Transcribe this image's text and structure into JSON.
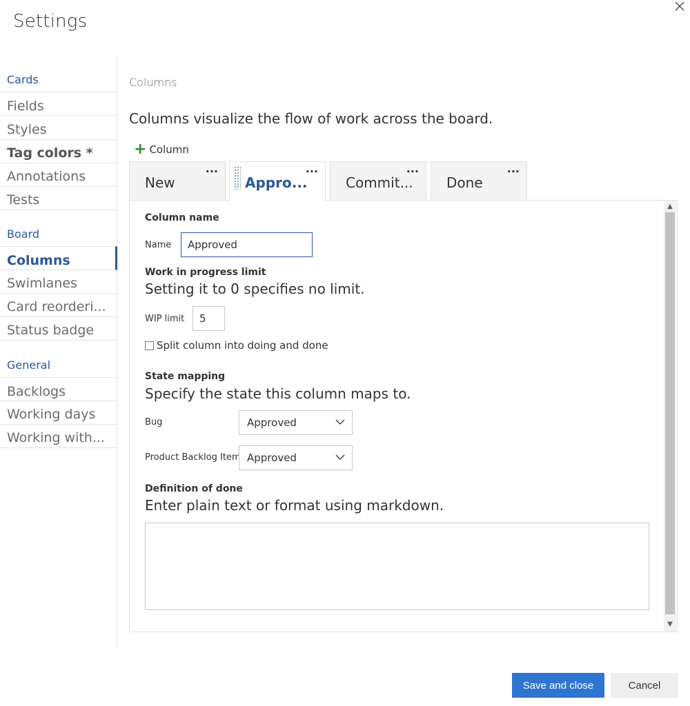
{
  "dialog": {
    "title": "Settings"
  },
  "sidebar": {
    "groups": [
      {
        "title": "Cards",
        "items": [
          "Fields",
          "Styles",
          "Tag colors *",
          "Annotations",
          "Tests"
        ]
      },
      {
        "title": "Board",
        "items": [
          "Columns",
          "Swimlanes",
          "Card reorderi...",
          "Status badge"
        ]
      },
      {
        "title": "General",
        "items": [
          "Backlogs",
          "Working days",
          "Working with..."
        ]
      }
    ],
    "active_item": "Columns"
  },
  "main": {
    "breadcrumb": "Columns",
    "description": "Columns visualize the flow of work across the board.",
    "add_column_label": "Column",
    "column_tabs": [
      {
        "label": "New",
        "more": "..."
      },
      {
        "label": "Appro...",
        "more": "..."
      },
      {
        "label": "Commit...",
        "more": "..."
      },
      {
        "label": "Done",
        "more": "..."
      }
    ],
    "selected_tab": "Appro..."
  },
  "form": {
    "column_name": {
      "section": "Column name",
      "label": "Name",
      "value": "Approved"
    },
    "wip": {
      "section": "Work in progress limit",
      "help": "Setting it to 0 specifies no limit.",
      "label": "WIP limit",
      "value": "5"
    },
    "split": {
      "label": "Split column into doing and done",
      "checked": false
    },
    "state_mapping": {
      "section": "State mapping",
      "help": "Specify the state this column maps to.",
      "rows": [
        {
          "label": "Bug",
          "value": "Approved"
        },
        {
          "label": "Product Backlog Item",
          "value": "Approved"
        }
      ]
    },
    "definition_of_done": {
      "section": "Definition of done",
      "help": "Enter plain text or format using markdown.",
      "value": ""
    }
  },
  "footer": {
    "save_label": "Save and close",
    "cancel_label": "Cancel"
  },
  "colors": {
    "accent": "#2b5797",
    "primary_button": "#2f76d2",
    "add_icon": "#2f8a2f"
  },
  "icons": {
    "close": "close-icon",
    "add": "plus-icon",
    "more": "ellipsis-icon",
    "dropdown": "chevron-down-icon",
    "drag": "drag-handle-icon"
  }
}
